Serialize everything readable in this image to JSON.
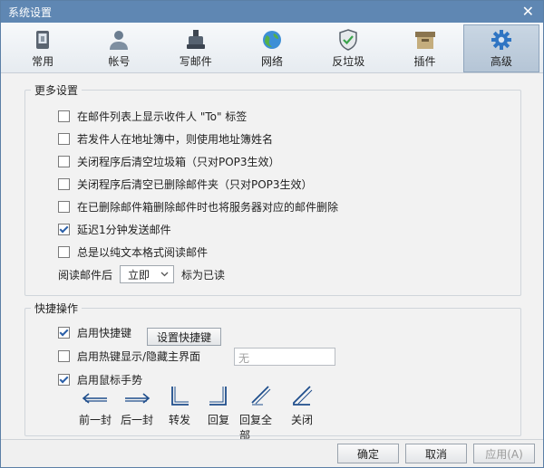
{
  "window": {
    "title": "系统设置",
    "close_glyph": "✕"
  },
  "tabs": [
    {
      "label": "常用",
      "icon": "phone-icon"
    },
    {
      "label": "帐号",
      "icon": "user-icon"
    },
    {
      "label": "写邮件",
      "icon": "inkpot-icon"
    },
    {
      "label": "网络",
      "icon": "globe-icon"
    },
    {
      "label": "反垃圾",
      "icon": "shield-icon"
    },
    {
      "label": "插件",
      "icon": "box-icon"
    },
    {
      "label": "高级",
      "icon": "gear-icon"
    }
  ],
  "active_tab": "高级",
  "more_settings": {
    "title": "更多设置",
    "options": [
      {
        "label": "在邮件列表上显示收件人 \"To\" 标签",
        "checked": false
      },
      {
        "label": "若发件人在地址簿中，则使用地址簿姓名",
        "checked": false
      },
      {
        "label": "关闭程序后清空垃圾箱（只对POP3生效）",
        "checked": false
      },
      {
        "label": "关闭程序后清空已删除邮件夹（只对POP3生效）",
        "checked": false
      },
      {
        "label": "在已删除邮件箱删除邮件时也将服务器对应的邮件删除",
        "checked": false
      },
      {
        "label": "延迟1分钟发送邮件",
        "checked": true
      },
      {
        "label": "总是以纯文本格式阅读邮件",
        "checked": false
      }
    ],
    "read_prefix": "阅读邮件后",
    "read_select": "立即",
    "read_suffix": "标为已读"
  },
  "shortcuts": {
    "title": "快捷操作",
    "enable_hotkeys": "启用快捷键",
    "enable_hotkeys_checked": true,
    "set_hotkeys_button": "设置快捷键",
    "hotkey_toggle": "启用热键显示/隐藏主界面",
    "hotkey_toggle_checked": false,
    "hotkey_value": "无",
    "mouse_gesture": "启用鼠标手势",
    "mouse_gesture_checked": true,
    "gestures": [
      "前一封",
      "后一封",
      "转发",
      "回复",
      "回复全部",
      "关闭"
    ]
  },
  "footer": {
    "ok": "确定",
    "cancel": "取消",
    "apply": "应用(A)"
  },
  "colors": {
    "titlebar": "#5f87b3",
    "accent": "#2a5fa8",
    "active_tab": "#b5c5d6"
  }
}
